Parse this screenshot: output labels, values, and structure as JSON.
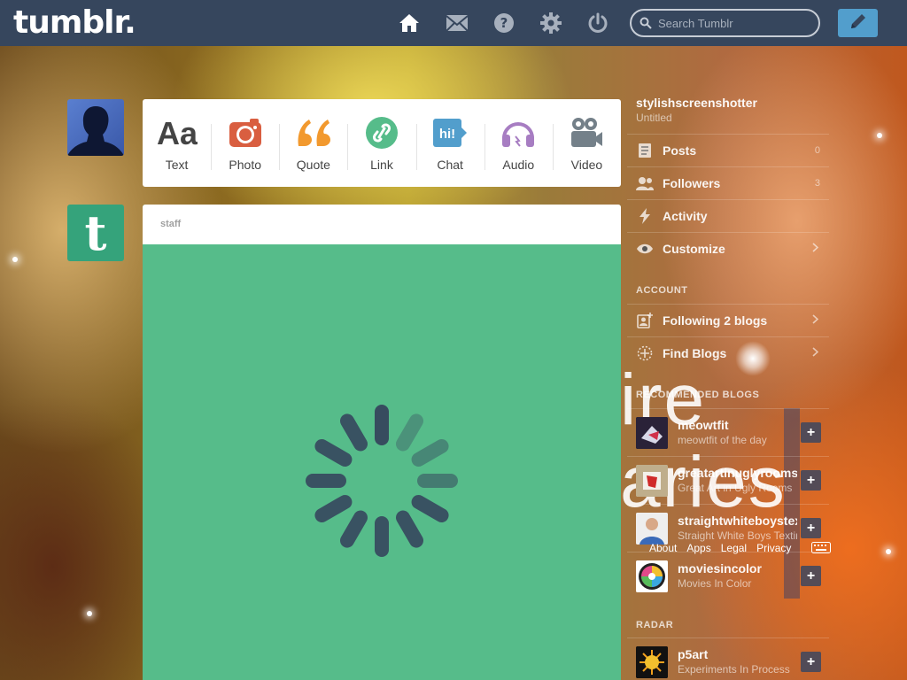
{
  "header": {
    "logo": "tumblr.",
    "search_placeholder": "Search Tumblr",
    "icons": [
      "home-icon",
      "mail-icon",
      "help-icon",
      "gear-icon",
      "power-icon",
      "compose-pencil-icon"
    ],
    "accent": "#529ecc",
    "bar_color": "#36465d"
  },
  "post_types": [
    {
      "label": "Text",
      "icon": "text-icon",
      "color": "#444444"
    },
    {
      "label": "Photo",
      "icon": "camera-icon",
      "color": "#d95e40"
    },
    {
      "label": "Quote",
      "icon": "quote-icon",
      "color": "#f2992e"
    },
    {
      "label": "Link",
      "icon": "link-icon",
      "color": "#56bc8a"
    },
    {
      "label": "Chat",
      "icon": "chat-icon",
      "color": "#529ecc"
    },
    {
      "label": "Audio",
      "icon": "headphones-icon",
      "color": "#a77dc2"
    },
    {
      "label": "Video",
      "icon": "video-camera-icon",
      "color": "#748089"
    }
  ],
  "post": {
    "author": "staff",
    "bg_color": "#56bc8a"
  },
  "sidebar": {
    "blog_name": "stylishscreenshotter",
    "blog_subtitle": "Untitled",
    "items": [
      {
        "label": "Posts",
        "count": "0",
        "icon": "posts-icon"
      },
      {
        "label": "Followers",
        "count": "3",
        "icon": "followers-icon"
      },
      {
        "label": "Activity",
        "count": "",
        "icon": "activity-icon"
      },
      {
        "label": "Customize",
        "count": "",
        "icon": "eye-icon"
      }
    ],
    "account_title": "ACCOUNT",
    "account_items": [
      {
        "label": "Following 2 blogs",
        "icon": "following-icon"
      },
      {
        "label": "Find Blogs",
        "icon": "find-blogs-icon"
      }
    ],
    "recommended_title": "RECOMMENDED BLOGS",
    "recommended": [
      {
        "name": "meowtfit",
        "sub": "meowtfit of the day"
      },
      {
        "name": "greatartinuglyrooms",
        "sub": "Great Art in Ugly Rooms"
      },
      {
        "name": "straightwhiteboystexting",
        "sub": "Straight White Boys Texting"
      },
      {
        "name": "moviesincolor",
        "sub": "Movies In Color"
      }
    ],
    "footer_links": [
      "About",
      "Apps",
      "Legal",
      "Privacy"
    ],
    "radar_title": "RADAR",
    "radar": {
      "name": "p5art",
      "sub": "Experiments In Process"
    }
  },
  "background_text": {
    "line1": "ire",
    "line2": "aries"
  }
}
